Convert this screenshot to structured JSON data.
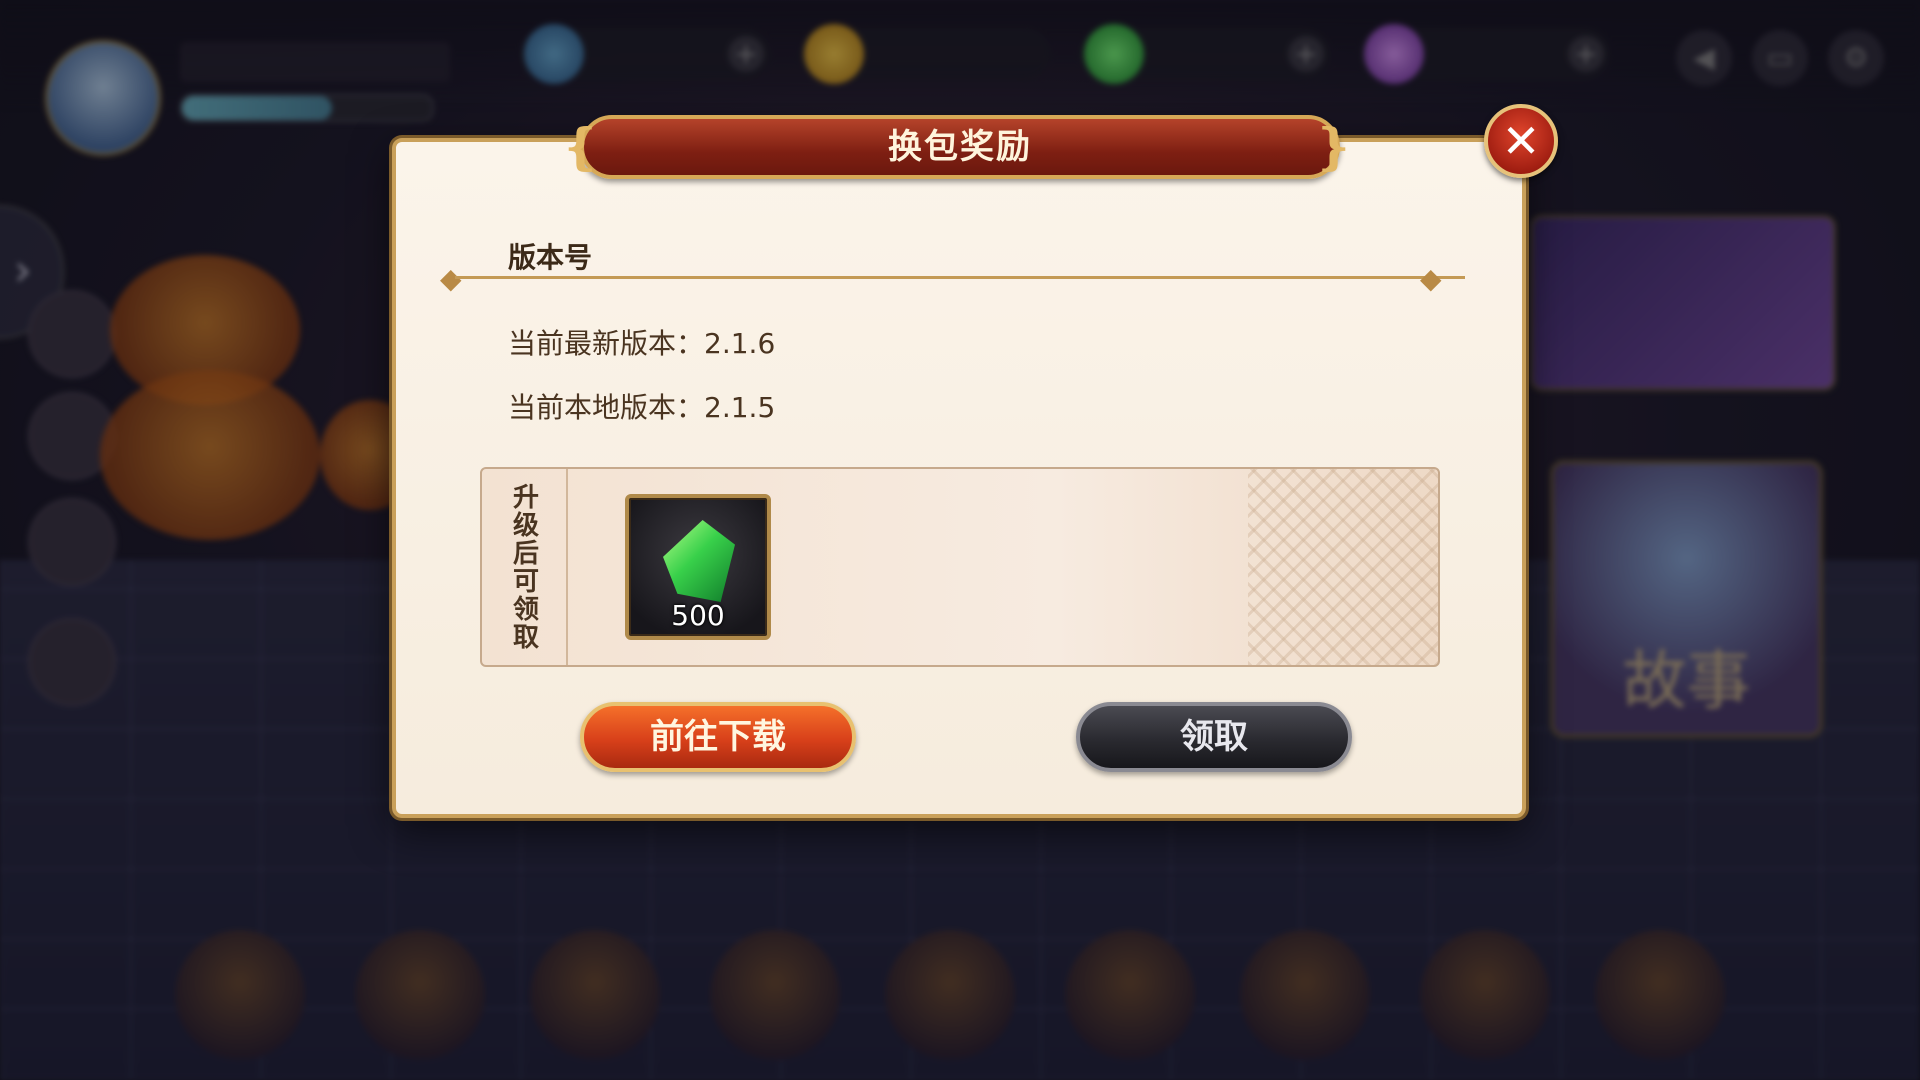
{
  "dialog": {
    "title": "换包奖励",
    "close_icon": "close-icon",
    "section_label": "版本号",
    "latest_version_label": "当前最新版本：",
    "latest_version_value": "2.1.6",
    "local_version_label": "当前本地版本：",
    "local_version_value": "2.1.5",
    "reward_side_label": "升级后可领取",
    "reward_item": {
      "icon": "green-crystal-icon",
      "count": "500"
    },
    "download_button": "前往下载",
    "claim_button": "领取"
  },
  "colors": {
    "title_bar": "#7e1f12",
    "dialog_bg": "#f6ecdd",
    "gold_border": "#c9a05a",
    "download_button": "#d8401a",
    "claim_button": "#2a2a30"
  }
}
